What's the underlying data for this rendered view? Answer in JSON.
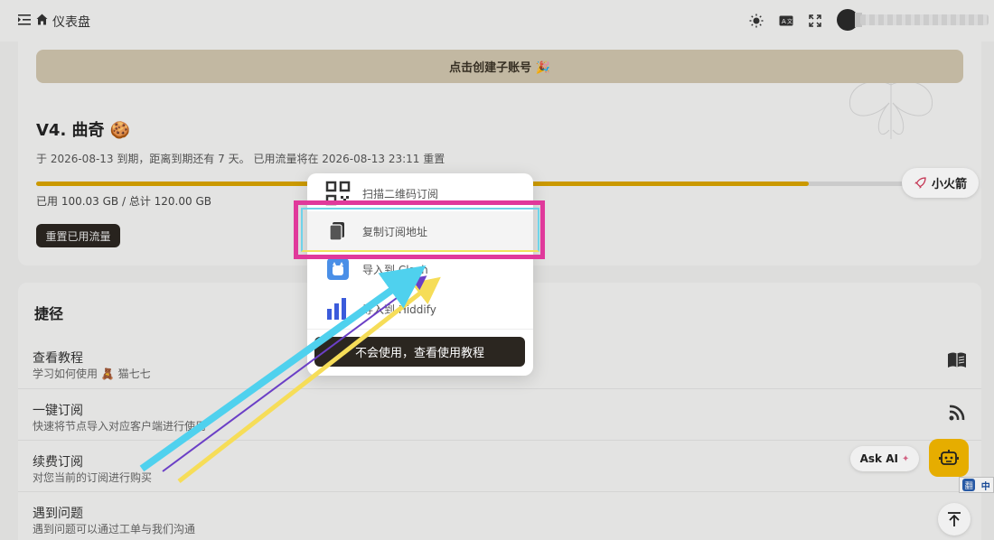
{
  "header": {
    "title": "仪表盘"
  },
  "subscription": {
    "create_sub_label": "点击创建子账号 🎉",
    "plan_title": "V4. 曲奇 🍪",
    "expiry_text": "于 2026-08-13 到期，距离到期还有 7 天。 已用流量将在 2026-08-13 23:11 重置",
    "usage_text": "已用 100.03 GB / 总计 120.00 GB",
    "usage_fraction": 0.8336,
    "reset_label": "重置已用流量"
  },
  "shortcuts": {
    "heading": "捷径",
    "items": [
      {
        "title": "查看教程",
        "desc": "学习如何使用 🧸 猫七七",
        "icon": "book-icon"
      },
      {
        "title": "一键订阅",
        "desc": "快速将节点导入对应客户端进行使用",
        "icon": "rss-icon"
      },
      {
        "title": "续费订阅",
        "desc": "对您当前的订阅进行购买",
        "icon": ""
      },
      {
        "title": "遇到问题",
        "desc": "遇到问题可以通过工单与我们沟通",
        "icon": ""
      }
    ]
  },
  "floating": {
    "rocket_label": "小火箭",
    "askai_label": "Ask AI",
    "lang_a": "翻",
    "lang_b": "中"
  },
  "popup": {
    "items": [
      {
        "label": "扫描二维码订阅",
        "icon": "qrcode-icon"
      },
      {
        "label": "复制订阅地址",
        "icon": "copy-icon"
      },
      {
        "label": "导入到 Clash",
        "icon": "clash-icon"
      },
      {
        "label": "导入到 Hiddify",
        "icon": "hiddify-icon"
      }
    ],
    "tutorial_label": "不会使用，查看使用教程"
  },
  "colors": {
    "accent": "#d8a300",
    "highlight": "#e0399b",
    "arrow_cyan": "#4fd1ee",
    "arrow_purple": "#6b3fc6",
    "arrow_yellow": "#f6dd58"
  }
}
